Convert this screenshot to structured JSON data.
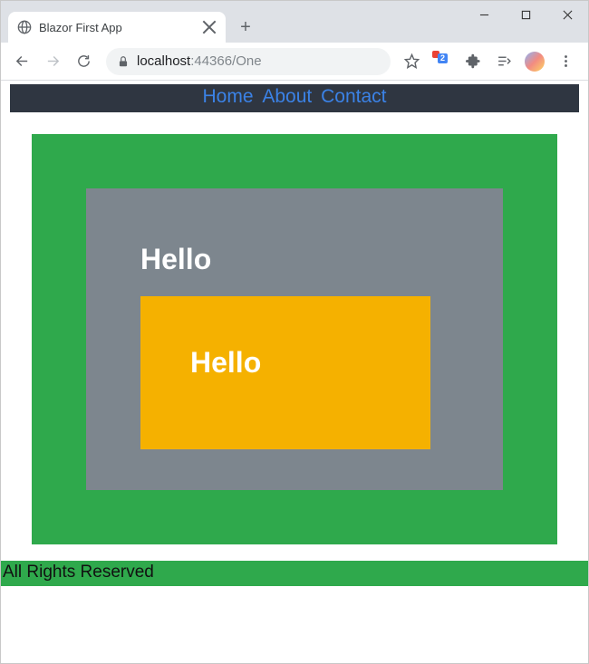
{
  "window": {
    "tab_title": "Blazor First App",
    "new_tab_glyph": "+"
  },
  "omnibox": {
    "host": "localhost",
    "port_path": ":44366/One"
  },
  "ext_badge_count": "2",
  "nav": {
    "home": "Home",
    "about": "About",
    "contact": "Contact"
  },
  "content": {
    "outer_heading": "Hello",
    "inner_heading": "Hello"
  },
  "footer_text": "All Rights Reserved"
}
